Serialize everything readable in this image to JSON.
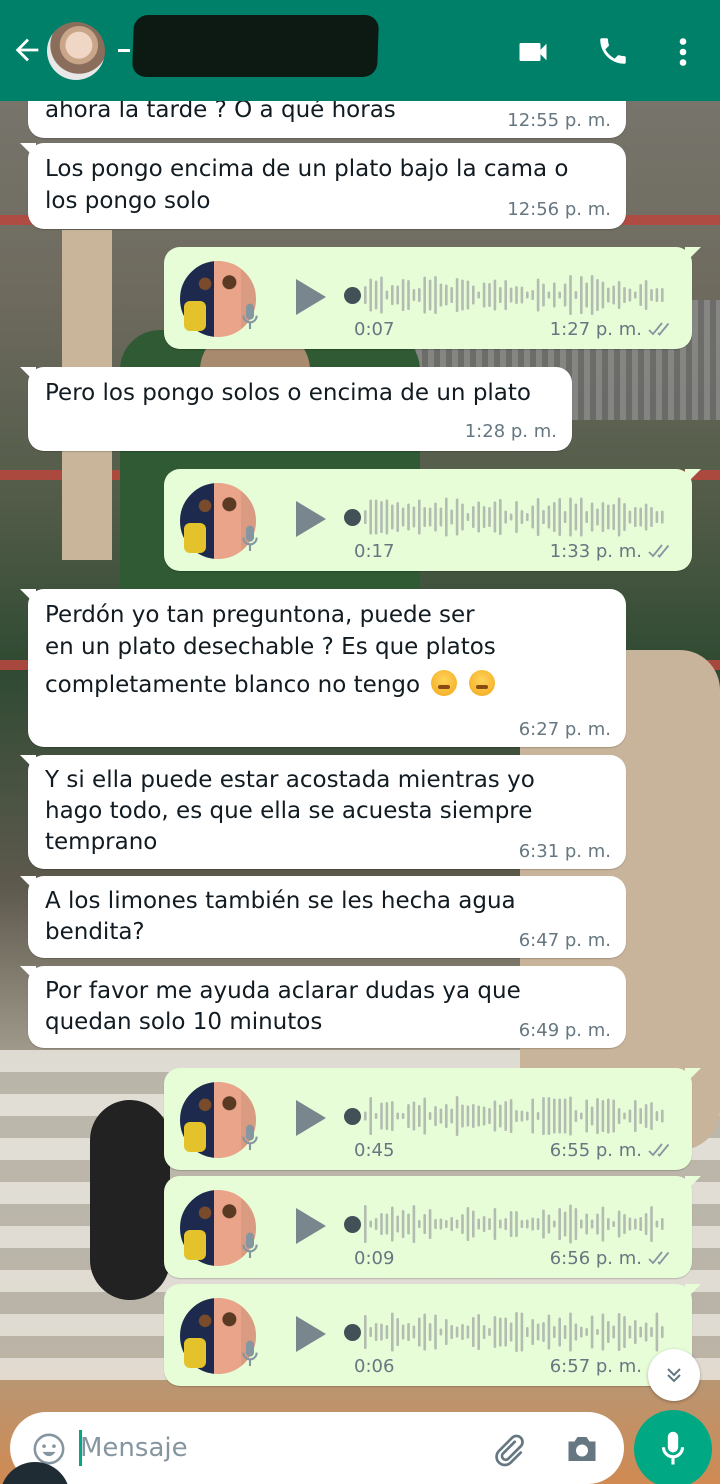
{
  "header": {
    "contact_name": "",
    "background": "#008069"
  },
  "icons": {
    "back": "back-arrow-icon",
    "video": "video-call-icon",
    "call": "phone-icon",
    "menu": "more-vert-icon",
    "emoji": "emoji-icon",
    "attach": "paperclip-icon",
    "camera": "camera-icon",
    "mic": "mic-icon",
    "scroll": "chevrons-down-icon"
  },
  "messages": [
    {
      "type": "text",
      "direction": "in",
      "lines": [
        "ahora la tarde ? O a qué horas"
      ],
      "time": "12:55 p. m."
    },
    {
      "type": "text",
      "direction": "in",
      "lines": [
        "Los pongo encima de un plato bajo la cama o",
        "los pongo solo"
      ],
      "time": "12:56 p. m."
    },
    {
      "type": "voice",
      "direction": "out",
      "duration": "0:07",
      "time": "1:27 p. m."
    },
    {
      "type": "text",
      "direction": "in",
      "lines": [
        "Pero los pongo solos  o encima de un plato"
      ],
      "time": "1:28 p. m."
    },
    {
      "type": "voice",
      "direction": "out",
      "duration": "0:17",
      "time": "1:33 p. m."
    },
    {
      "type": "text",
      "direction": "in",
      "lines": [
        "Perdón yo tan preguntona, puede ser",
        "en un plato desechable ? Es que platos",
        "completamente blanco no tengo"
      ],
      "time": "6:27 p. m."
    },
    {
      "type": "text",
      "direction": "in",
      "lines": [
        "Y si ella puede estar acostada mientras yo",
        "hago todo, es que ella se acuesta siempre",
        "temprano"
      ],
      "time": "6:31 p. m."
    },
    {
      "type": "text",
      "direction": "in",
      "lines": [
        "A los limones también se les hecha agua",
        "bendita?"
      ],
      "time": "6:47 p. m."
    },
    {
      "type": "text",
      "direction": "in",
      "lines": [
        "Por favor me ayuda aclarar dudas ya que",
        "quedan solo 10 minutos"
      ],
      "time": "6:49 p. m."
    },
    {
      "type": "voice",
      "direction": "out",
      "duration": "0:45",
      "time": "6:55 p. m."
    },
    {
      "type": "voice",
      "direction": "out",
      "duration": "0:09",
      "time": "6:56 p. m."
    },
    {
      "type": "voice",
      "direction": "out",
      "duration": "0:06",
      "time": "6:57 p. m."
    }
  ],
  "composer": {
    "placeholder": "Mensaje"
  },
  "colors": {
    "accent": "#00a884",
    "incoming_bubble": "#ffffff",
    "outgoing_bubble": "#e7fdd8",
    "read_ticks": "#8696a0"
  }
}
